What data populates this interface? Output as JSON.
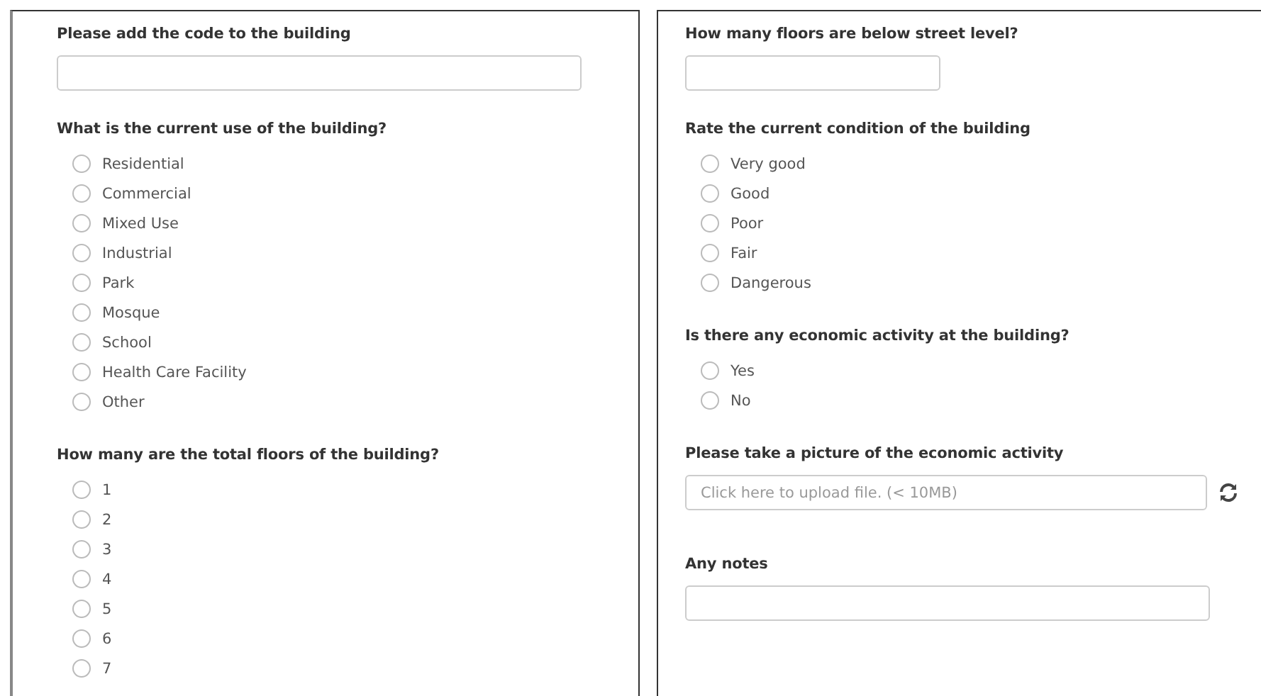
{
  "columns": [
    {
      "questions": [
        {
          "kind": "text",
          "title": "Please add the code to the building"
        },
        {
          "kind": "radio",
          "title": "What is the current use of the building?",
          "options": [
            {
              "label": "Residential",
              "selected": false
            },
            {
              "label": "Commercial",
              "selected": false
            },
            {
              "label": "Mixed Use",
              "selected": false
            },
            {
              "label": "Industrial",
              "selected": false
            },
            {
              "label": "Park",
              "selected": false
            },
            {
              "label": "Mosque",
              "selected": false
            },
            {
              "label": "School",
              "selected": false
            },
            {
              "label": "Health Care Facility",
              "selected": false
            },
            {
              "label": "Other",
              "selected": false
            }
          ]
        },
        {
          "kind": "radio",
          "title": "How many are the total floors of the building?",
          "options": [
            {
              "label": "1",
              "selected": false
            },
            {
              "label": "2",
              "selected": false
            },
            {
              "label": "3",
              "selected": false
            },
            {
              "label": "4",
              "selected": false
            },
            {
              "label": "5",
              "selected": false
            },
            {
              "label": "6",
              "selected": false
            },
            {
              "label": "7",
              "selected": false
            }
          ]
        }
      ]
    },
    {
      "questions": [
        {
          "kind": "short_text",
          "title": "How many floors are below street level?"
        },
        {
          "kind": "radio",
          "title": "Rate the current condition of the building",
          "options": [
            {
              "label": "Very good",
              "selected": false
            },
            {
              "label": "Good",
              "selected": false
            },
            {
              "label": "Poor",
              "selected": false
            },
            {
              "label": "Fair",
              "selected": false
            },
            {
              "label": "Dangerous",
              "selected": false
            }
          ]
        },
        {
          "kind": "radio",
          "title": "Is there any economic activity at the building?",
          "options": [
            {
              "label": "Yes",
              "selected": false
            },
            {
              "label": "No",
              "selected": false
            }
          ]
        },
        {
          "kind": "upload",
          "title": "Please take a picture of the economic activity",
          "placeholder": "Click here to upload file. (< 10MB)"
        },
        {
          "kind": "text",
          "title": "Any notes"
        }
      ]
    }
  ]
}
